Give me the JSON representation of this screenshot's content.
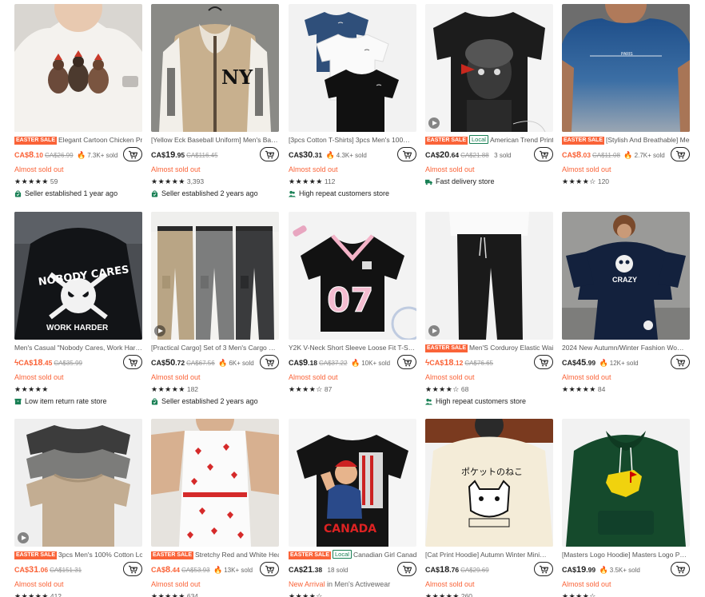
{
  "colors": {
    "accent": "#fa6338",
    "green": "#198055",
    "text": "#222222"
  },
  "products": [
    {
      "title": "Elegant Cartoon Chicken Prin…",
      "sale_badge": "EASTER SALE",
      "local_badge": "",
      "price_cur": "CA$",
      "price_int": "8",
      "price_dec": ".10",
      "price_color": "accent",
      "old_price": "CA$26.99",
      "sold": "7.3K+ sold",
      "hot": true,
      "status": "Almost sold out",
      "stars": "★★★★★",
      "reviews": "59",
      "store": "Seller established 1 year ago",
      "store_icon": "shop-bag-icon",
      "video": false,
      "img": "chicken-tee"
    },
    {
      "title": "[Yellow Eck Baseball Uniform] Men's Ba…",
      "sale_badge": "",
      "local_badge": "",
      "price_cur": "CA$",
      "price_int": "19",
      "price_dec": ".95",
      "price_color": "dark",
      "old_price": "CA$116.45",
      "sold": "",
      "hot": false,
      "status": "Almost sold out",
      "stars": "★★★★★",
      "reviews": "3,393",
      "store": "Seller established 2 years ago",
      "store_icon": "shop-bag-icon",
      "video": false,
      "img": "varsity-hoodie"
    },
    {
      "title": "[3pcs Cotton T-Shirts] 3pcs Men's 100…",
      "sale_badge": "",
      "local_badge": "",
      "price_cur": "CA$",
      "price_int": "30",
      "price_dec": ".31",
      "price_color": "dark",
      "old_price": "",
      "sold": "4.3K+ sold",
      "hot": true,
      "status": "Almost sold out",
      "stars": "★★★★★",
      "reviews": "112",
      "store": "High repeat customers store",
      "store_icon": "users-icon",
      "video": false,
      "img": "three-tees"
    },
    {
      "title": "American Trend Printi…",
      "sale_badge": "EASTER SALE",
      "local_badge": "Local",
      "price_cur": "CA$",
      "price_int": "20",
      "price_dec": ".64",
      "price_color": "dark",
      "old_price": "CA$21.88",
      "sold": "3 sold",
      "hot": false,
      "status": "Almost sold out",
      "stars": "",
      "reviews": "",
      "store": "Fast delivery store",
      "store_icon": "truck-icon",
      "video": true,
      "img": "portrait-tee"
    },
    {
      "title": "[Stylish And Breathable] Men…",
      "sale_badge": "EASTER SALE",
      "local_badge": "",
      "price_cur": "CA$",
      "price_int": "8",
      "price_dec": ".03",
      "price_color": "accent",
      "old_price": "CA$11.08",
      "sold": "2.7K+ sold",
      "hot": true,
      "status": "Almost sold out",
      "stars": "★★★★☆",
      "reviews": "120",
      "store": "",
      "store_icon": "",
      "video": false,
      "img": "blue-gradient-tee"
    },
    {
      "title": "Men's Casual \"Nobody Cares, Work Har…",
      "sale_badge": "",
      "local_badge": "",
      "price_cur": "CA$",
      "price_int": "18",
      "price_dec": ".45",
      "price_color": "accent",
      "old_price": "CA$35.99",
      "sold": "",
      "hot": false,
      "lightning": true,
      "status": "Almost sold out",
      "stars": "★★★★★",
      "reviews": "",
      "store": "Low item return rate store",
      "store_icon": "box-icon",
      "video": false,
      "img": "nobody-cares-hoodie"
    },
    {
      "title": "[Practical Cargo] Set of 3 Men's Cargo …",
      "sale_badge": "",
      "local_badge": "",
      "price_cur": "CA$",
      "price_int": "50",
      "price_dec": ".72",
      "price_color": "dark",
      "old_price": "CA$67.56",
      "sold": "6K+ sold",
      "hot": true,
      "status": "Almost sold out",
      "stars": "★★★★★",
      "reviews": "182",
      "store": "Seller established 2 years ago",
      "store_icon": "shop-bag-icon",
      "video": true,
      "img": "cargo-pants"
    },
    {
      "title": "Y2K V-Neck Short Sleeve Loose Fit T-S…",
      "sale_badge": "",
      "local_badge": "",
      "price_cur": "CA$",
      "price_int": "9",
      "price_dec": ".18",
      "price_color": "dark",
      "old_price": "CA$37.22",
      "sold": "10K+ sold",
      "hot": true,
      "status": "Almost sold out",
      "stars": "★★★★☆",
      "reviews": "87",
      "store": "",
      "store_icon": "",
      "video": false,
      "img": "jersey-07"
    },
    {
      "title": "Men'S Corduroy Elastic Waist…",
      "sale_badge": "EASTER SALE",
      "local_badge": "",
      "price_cur": "CA$",
      "price_int": "18",
      "price_dec": ".12",
      "price_color": "accent",
      "old_price": "CA$76.65",
      "sold": "",
      "hot": false,
      "lightning": true,
      "status": "Almost sold out",
      "stars": "★★★★☆",
      "reviews": "68",
      "store": "High repeat customers store",
      "store_icon": "users-icon",
      "video": true,
      "img": "black-pants"
    },
    {
      "title": "2024 New Autumn/Winter Fashion Wo…",
      "sale_badge": "",
      "local_badge": "",
      "price_cur": "CA$",
      "price_int": "45",
      "price_dec": ".99",
      "price_color": "dark",
      "old_price": "",
      "sold": "12K+ sold",
      "hot": true,
      "status": "Almost sold out",
      "stars": "★★★★★",
      "reviews": "84",
      "store": "",
      "store_icon": "",
      "video": false,
      "img": "crazy-set"
    },
    {
      "title": "3pcs Men's 100% Cotton Loo…",
      "sale_badge": "EASTER SALE",
      "local_badge": "",
      "price_cur": "CA$",
      "price_int": "31",
      "price_dec": ".06",
      "price_color": "accent",
      "old_price": "CA$151.31",
      "sold": "",
      "hot": false,
      "status": "Almost sold out",
      "stars": "★★★★★",
      "reviews": "412",
      "store": "",
      "store_icon": "",
      "video": true,
      "img": "washed-tees"
    },
    {
      "title": "Stretchy Red and White Hear…",
      "sale_badge": "EASTER SALE",
      "local_badge": "",
      "price_cur": "CA$",
      "price_int": "8",
      "price_dec": ".44",
      "price_color": "accent",
      "old_price": "CA$53.93",
      "sold": "13K+ sold",
      "hot": true,
      "status": "Almost sold out",
      "stars": "★★★★★",
      "reviews": "634",
      "store": "",
      "store_icon": "",
      "video": false,
      "img": "heart-set"
    },
    {
      "title": "Canadian Girl Canada …",
      "sale_badge": "EASTER SALE",
      "local_badge": "Local",
      "price_cur": "CA$",
      "price_int": "21",
      "price_dec": ".38",
      "price_color": "dark",
      "old_price": "",
      "sold": "18 sold",
      "hot": false,
      "status": "",
      "new_arrival": "New Arrival",
      "new_arrival_cat": "in Men's Activewear",
      "stars": "★★★★☆",
      "reviews": "",
      "store": "",
      "store_icon": "",
      "video": false,
      "img": "canada-tee"
    },
    {
      "title": "[Cat Print Hoodie] Autumn Winter Mini…",
      "sale_badge": "",
      "local_badge": "",
      "price_cur": "CA$",
      "price_int": "18",
      "price_dec": ".76",
      "price_color": "dark",
      "old_price": "CA$29.69",
      "sold": "",
      "hot": false,
      "status": "Almost sold out",
      "stars": "★★★★★",
      "reviews": "260",
      "store": "",
      "store_icon": "",
      "video": false,
      "img": "cat-hoodie"
    },
    {
      "title": "[Masters Logo Hoodie] Masters Logo P…",
      "sale_badge": "",
      "local_badge": "",
      "price_cur": "CA$",
      "price_int": "19",
      "price_dec": ".99",
      "price_color": "dark",
      "old_price": "",
      "sold": "3.5K+ sold",
      "hot": true,
      "status": "Almost sold out",
      "stars": "★★★★☆",
      "reviews": "",
      "store": "",
      "store_icon": "",
      "video": false,
      "img": "masters-hoodie"
    }
  ],
  "icons": {
    "cart": "add-to-cart-icon",
    "hot": "flame-icon",
    "video": "play-icon"
  }
}
